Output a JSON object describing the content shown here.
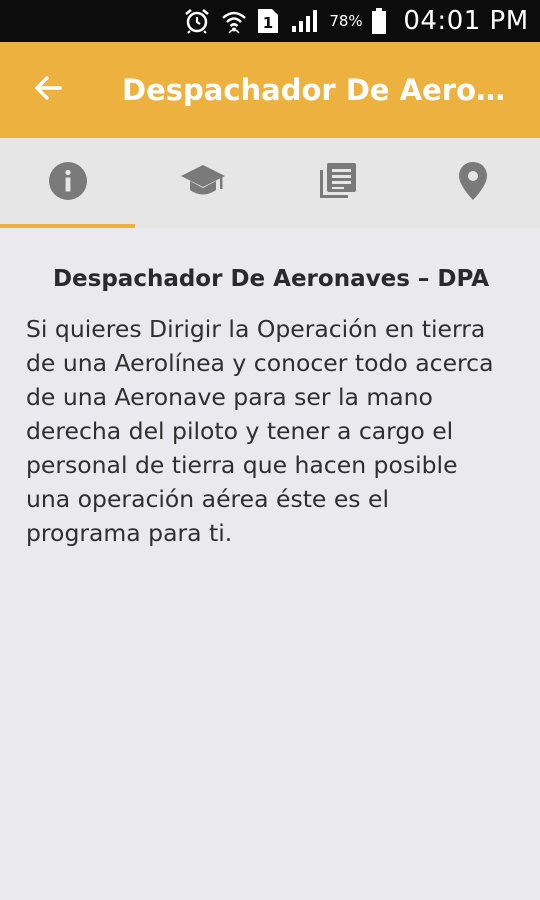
{
  "status_bar": {
    "sim_slot": "1",
    "battery_percent": "78%",
    "time": "04:01 PM",
    "icons": [
      "alarm-icon",
      "wifi-icon",
      "sim-icon",
      "signal-icon",
      "battery-icon"
    ]
  },
  "app_bar": {
    "title": "Despachador De Aeronaves – DPA",
    "back_icon": "back-arrow-icon",
    "color": "#ecb13f"
  },
  "tabs": [
    {
      "icon": "info-icon",
      "active": true
    },
    {
      "icon": "graduation-cap-icon",
      "active": false
    },
    {
      "icon": "articles-icon",
      "active": false
    },
    {
      "icon": "location-pin-icon",
      "active": false
    }
  ],
  "content": {
    "title": "Despachador De Aeronaves – DPA",
    "body": "Si quieres Dirigir la Operación en tierra de una Aerolínea y conocer todo acerca de una Aeronave para ser la mano derecha del piloto y tener a cargo el personal de tierra que hacen posible una operación aérea éste es el programa para ti."
  }
}
